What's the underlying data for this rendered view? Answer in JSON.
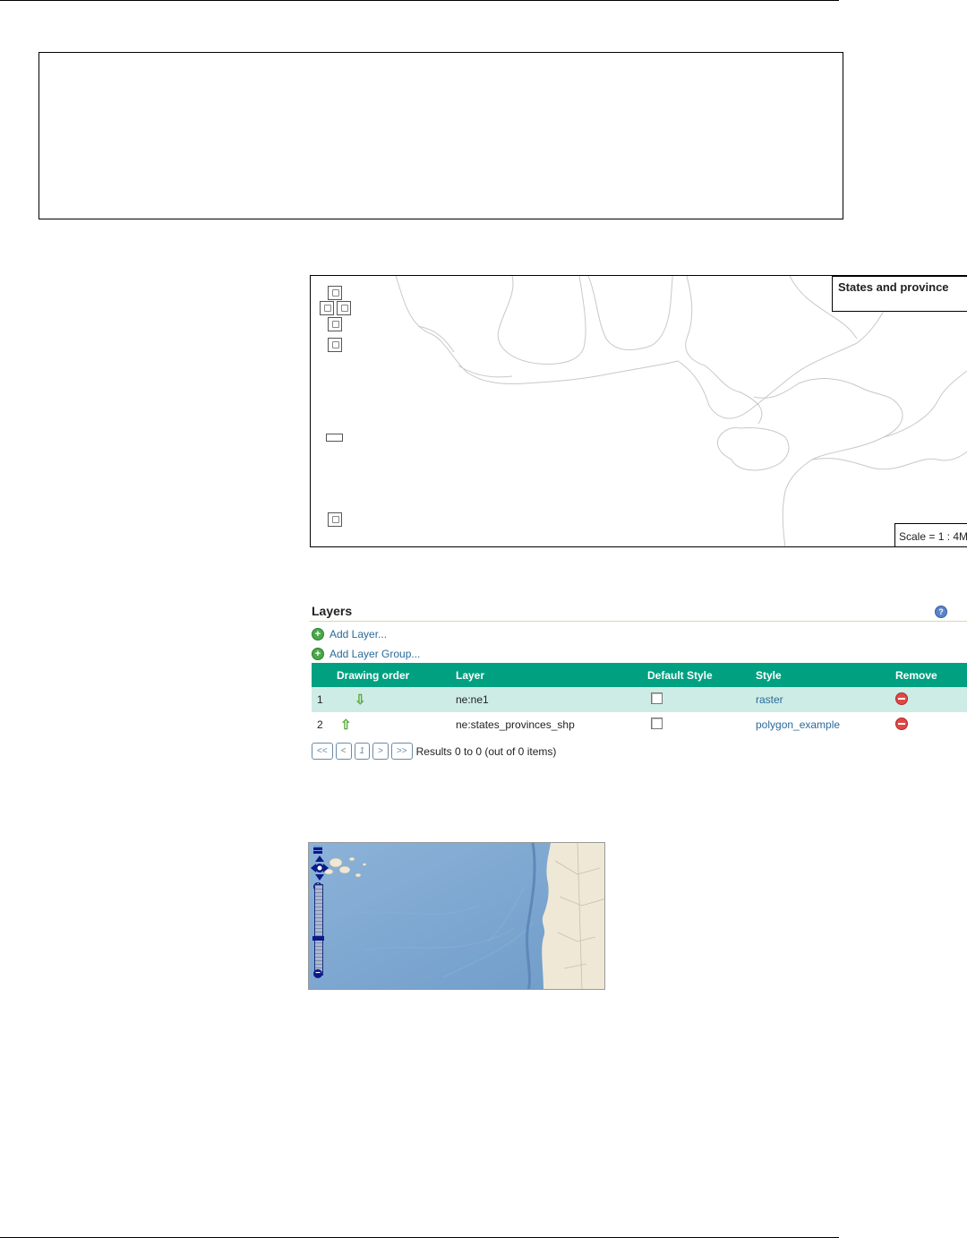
{
  "map_preview": {
    "legend_title": "States and province",
    "scale": "Scale = 1 : 4M",
    "controls": [
      "pan-up-icon",
      "pan-left-icon",
      "pan-right-icon",
      "pan-down-icon",
      "zoom-in-icon",
      "zoom-out-icon"
    ]
  },
  "layers": {
    "title": "Layers",
    "add_layer": "Add Layer...",
    "add_layer_group": "Add Layer Group...",
    "columns": [
      "Drawing order",
      "Layer",
      "Default Style",
      "Style",
      "Remove"
    ],
    "rows": [
      {
        "order": "1",
        "arrow": "⇩",
        "layer": "ne:ne1",
        "default_style": false,
        "style": "raster"
      },
      {
        "order": "2",
        "arrow": "⇧",
        "layer": "ne:states_provinces_shp",
        "default_style": false,
        "style": "polygon_example"
      }
    ],
    "pager": {
      "first": "<<",
      "prev": "<",
      "page": "1",
      "next": ">",
      "last": ">>",
      "results": "Results 0 to 0 (out of 0 items)"
    }
  },
  "colors": {
    "header_bg": "#00a080",
    "row_highlight": "#cdece5",
    "link": "#2a6a9a",
    "ocean": "#7aa4d0",
    "land": "#efe8d6"
  }
}
